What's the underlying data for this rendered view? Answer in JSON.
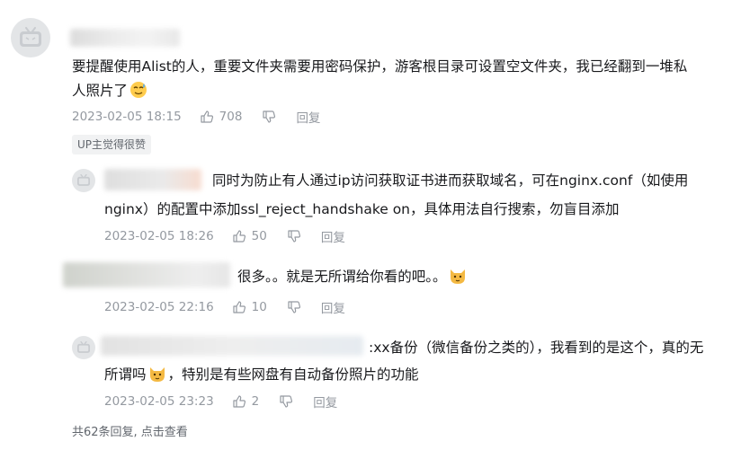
{
  "root_comment": {
    "text_line1": "要提醒使用Alist的人，重要文件夹需要用密码保护，游客根目录可设置空文件夹，我已经翻到一堆私",
    "text_line2": "人照片了",
    "emoji": "sweat-emoji",
    "time": "2023-02-05 18:15",
    "likes": "708",
    "reply_label": "回复",
    "badge": "UP主觉得很赞"
  },
  "replies": [
    {
      "text_line1": "同时为防止有人通过ip访问获取证书进而获取域名，可在nginx.conf（如使用",
      "text_line2": "nginx）的配置中添加ssl_reject_handshake on，具体用法自行搜索，勿盲目添加",
      "time": "2023-02-05 18:26",
      "likes": "50",
      "reply_label": "回复"
    },
    {
      "text_line1": "很多。。就是无所谓给你看的吧。。",
      "emoji": "cat-emoji",
      "time": "2023-02-05 22:16",
      "likes": "10",
      "reply_label": "回复"
    },
    {
      "text_line1": ":xx备份（微信备份之类的），我看到的是这个，真的无",
      "text_line2a": "所谓吗",
      "text_line2b": "，特别是有些网盘有自动备份照片的功能",
      "emoji": "cat-emoji",
      "time": "2023-02-05 23:23",
      "likes": "2",
      "reply_label": "回复"
    }
  ],
  "view_more": "共62条回复, 点击查看",
  "colors": {
    "meta": "#9499a0",
    "text": "#18191c",
    "avatar": "#e3e5e7"
  }
}
